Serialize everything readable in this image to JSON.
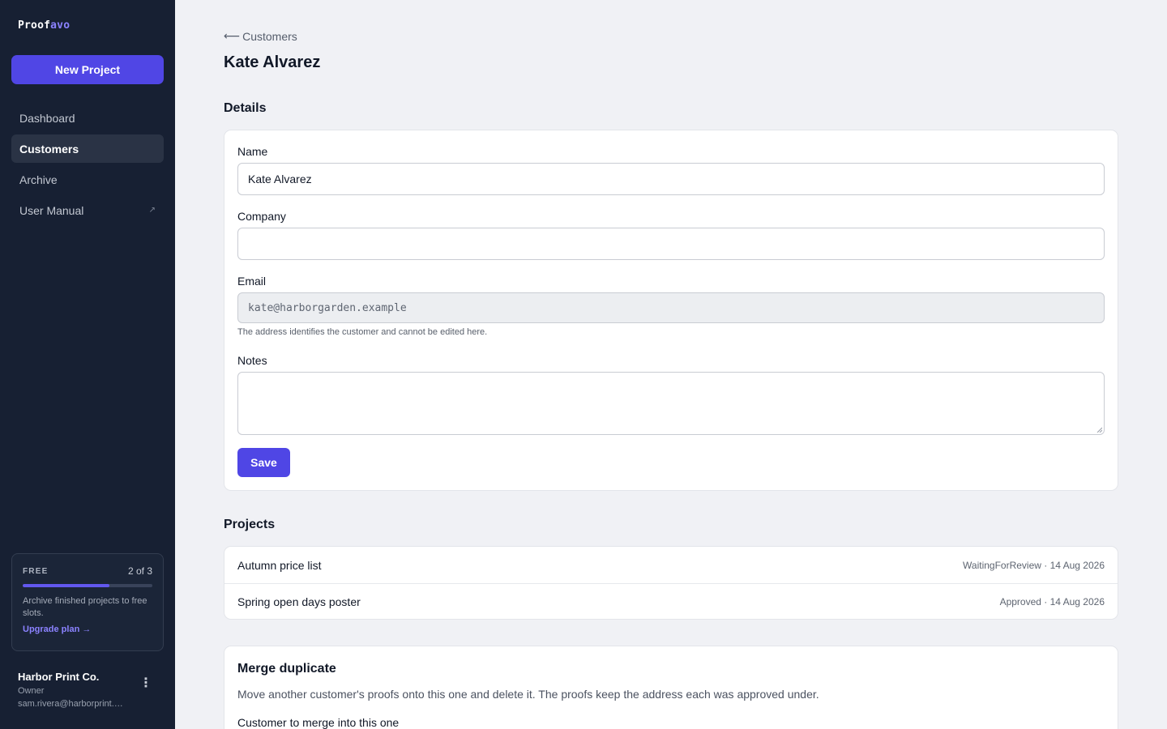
{
  "sidebar": {
    "logo_part1": "Proof",
    "logo_part2": "avo",
    "new_project_label": "New Project",
    "nav": [
      {
        "label": "Dashboard",
        "active": false
      },
      {
        "label": "Customers",
        "active": true
      },
      {
        "label": "Archive",
        "active": false
      },
      {
        "label": "User Manual",
        "active": false,
        "external": true,
        "icon": "external-link-icon"
      }
    ],
    "plan": {
      "tier": "FREE",
      "count": "2 of 3",
      "used_fraction": 0.67,
      "text": "Archive finished projects to free slots.",
      "link": "Upgrade plan →"
    },
    "account": {
      "name": "Harbor Print Co.",
      "role": "Owner",
      "email": "sam.rivera@harborprint.e…"
    }
  },
  "header": {
    "back_label": "Customers",
    "back_icon": "arrow-left-icon",
    "title": "Kate Alvarez"
  },
  "details": {
    "section_title": "Details",
    "name_label": "Name",
    "name_value": "Kate Alvarez",
    "company_label": "Company",
    "company_value": "",
    "email_label": "Email",
    "email_value": "kate@harborgarden.example",
    "email_hint": "The address identifies the customer and cannot be edited here.",
    "notes_label": "Notes",
    "notes_value": "",
    "save_label": "Save"
  },
  "projects": {
    "section_title": "Projects",
    "items": [
      {
        "name": "Autumn price list",
        "meta": "WaitingForReview · 14 Aug 2026"
      },
      {
        "name": "Spring open days poster",
        "meta": "Approved · 14 Aug 2026"
      }
    ]
  },
  "merge": {
    "title": "Merge duplicate",
    "description": "Move another customer's proofs onto this one and delete it. The proofs keep the address each was approved under.",
    "select_label": "Customer to merge into this one"
  },
  "colors": {
    "sidebar_bg": "#172033",
    "accent": "#4f46e5",
    "logo_accent": "#8b82ff"
  }
}
